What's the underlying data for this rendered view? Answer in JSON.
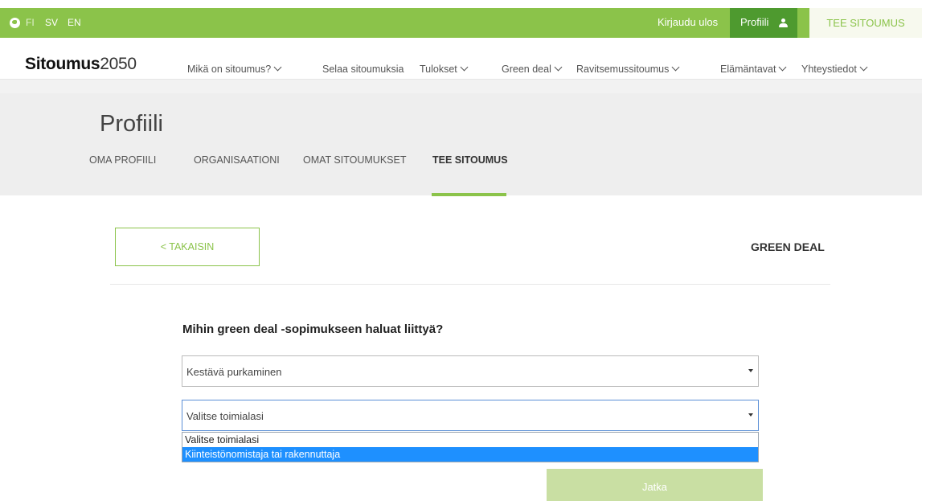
{
  "topbar": {
    "languages": [
      "FI",
      "SV",
      "EN"
    ],
    "logout": "Kirjaudu ulos",
    "profile": "Profiili",
    "commit_button": "TEE SITOUMUS"
  },
  "logo": {
    "bold": "Sitoumus",
    "num": "2050"
  },
  "nav": {
    "items": [
      "Mikä on sitoumus?",
      "Selaa sitoumuksia",
      "Tulokset",
      "Green deal",
      "Ravitsemussitoumus",
      "Elämäntavat",
      "Yhteystiedot"
    ]
  },
  "page": {
    "title": "Profiili",
    "tabs": [
      "OMA PROFIILI",
      "ORGANISAATIONI",
      "OMAT SITOUMUKSET",
      "TEE SITOUMUS"
    ],
    "active_tab": "TEE SITOUMUS"
  },
  "main": {
    "back": "< TAKAISIN",
    "section": "GREEN DEAL",
    "question": "Mihin green deal -sopimukseen haluat liittyä?",
    "deal_select": "Kestävä purkaminen",
    "industry_select": "Valitse toimialasi",
    "options": [
      "Valitse toimialasi",
      "Kiinteistönomistaja tai rakennuttaja"
    ],
    "next": "Jatka"
  },
  "colors": {
    "accent": "#8bc34a",
    "accent_dark": "#4e9a2f",
    "highlight": "#1e90ff"
  }
}
